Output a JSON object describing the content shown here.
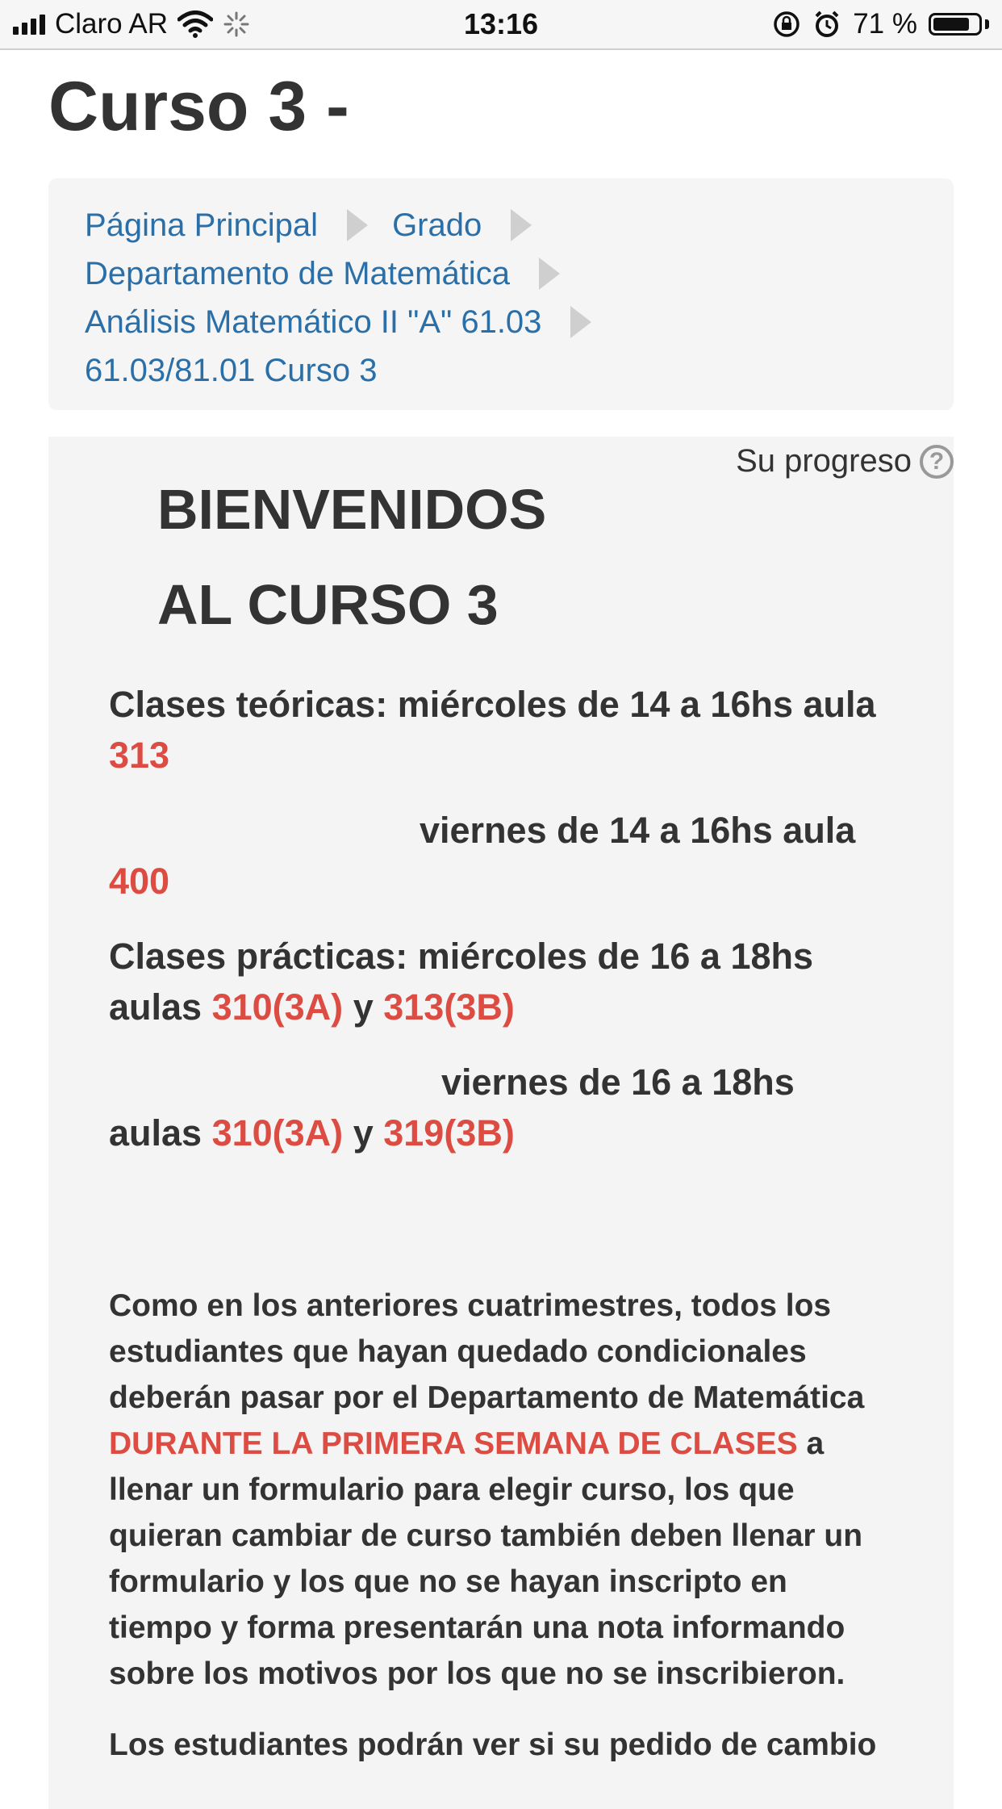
{
  "status_bar": {
    "carrier": "Claro AR",
    "time": "13:16",
    "battery_percent": "71 %",
    "battery_level": 0.71
  },
  "page": {
    "title": "Curso 3 -"
  },
  "breadcrumb": {
    "items": [
      "Página Principal",
      "Grado",
      "Departamento de Matemática",
      "Análisis Matemático II \"A\" 61.03",
      "61.03/81.01 Curso 3"
    ]
  },
  "progress": {
    "label": "Su progreso",
    "help_icon": "question-circle-icon"
  },
  "welcome": {
    "line1": "BIENVENIDOS",
    "line2": "AL CURSO 3"
  },
  "schedule": {
    "teoricas_label": "Clases teóricas: miércoles de 14 a 16hs aula",
    "teoricas_room1": "313",
    "teoricas_viernes": "viernes de 14 a 16hs aula",
    "teoricas_room2": "400",
    "practicas_label": "Clases prácticas: miércoles de 16 a 18hs",
    "aulas_word": "aulas",
    "y_word": "y",
    "practicas_mie_room_a": "310(3A)",
    "practicas_mie_room_b": "313(3B)",
    "practicas_viernes": "viernes de 16 a 18hs",
    "practicas_vie_room_a": "310(3A)",
    "practicas_vie_room_b": "319(3B)"
  },
  "notice": {
    "line1": "Como en los anteriores cuatrimestres, todos los",
    "line2": "estudiantes que hayan quedado condicionales",
    "line3": "deberán pasar por el Departamento de Matemática",
    "highlight": "DURANTE LA PRIMERA SEMANA DE CLASES",
    "line4_tail": "a",
    "line5": "llenar un formulario para elegir curso, los que",
    "line6": "quieran cambiar de curso también deben llenar un",
    "line7": "formulario y los que no se hayan inscripto en",
    "line8": "tiempo y forma presentarán una nota informando",
    "line9": "sobre los motivos por los que no se inscribieron.",
    "next_para": "Los estudiantes podrán ver si su pedido de cambio"
  },
  "colors": {
    "link": "#2a6fa8",
    "accent_red": "#dc4c42",
    "text": "#333333",
    "panel": "#f4f4f4"
  }
}
